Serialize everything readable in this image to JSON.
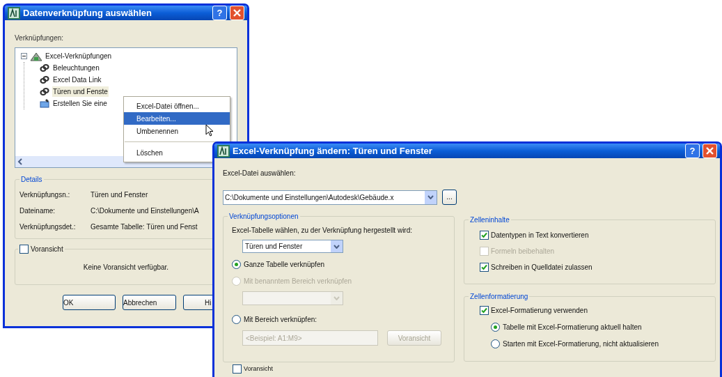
{
  "link_dialog": {
    "title": "Datenverknüpfung auswählen",
    "help_label": "?",
    "tree_label": "Verknüpfungen:",
    "tree": {
      "label": "Excel-Verknüpfungen",
      "expanded": true,
      "children": [
        {
          "label": "Beleuchtungen",
          "kind": "link",
          "selected": false
        },
        {
          "label": "Excel Data Link",
          "kind": "link",
          "selected": false
        },
        {
          "label": "Türen und Fenste",
          "kind": "link",
          "selected": true
        },
        {
          "label": "Erstellen Sie eine",
          "kind": "create",
          "selected": false
        }
      ]
    },
    "details": {
      "title": "Details",
      "rows": [
        {
          "label": "Verknüpfungsn.:",
          "value": "Türen und Fenster"
        },
        {
          "label": "Dateiname:",
          "value": "C:\\Dokumente und Einstellungen\\A"
        },
        {
          "label": "Verknüpfungsdet.:",
          "value": "Gesamte Tabelle: Türen und Fenst"
        }
      ]
    },
    "preview": {
      "label": "Voransicht",
      "checked": false,
      "message": "Keine Voransicht verfügbar."
    },
    "buttons": [
      "OK",
      "Abbrechen",
      "Hi"
    ]
  },
  "context_menu": [
    {
      "kind": "item",
      "label": "Excel-Datei öffnen...",
      "selected": false
    },
    {
      "kind": "item",
      "label": "Bearbeiten...",
      "selected": true
    },
    {
      "kind": "item",
      "label": "Umbenennen",
      "selected": false
    },
    {
      "kind": "separator"
    },
    {
      "kind": "item",
      "label": "Löschen",
      "selected": false
    }
  ],
  "edit_dialog": {
    "title": "Excel-Verknüpfung ändern: Türen und Fenster",
    "help_label": "?",
    "file_label": "Excel-Datei auswählen:",
    "file_value": "C:\\Dokumente und Einstellungen\\Autodesk\\Gebäude.x",
    "browse_label": "...",
    "options": {
      "title": "Verknüpfungsoptionen",
      "sheet_label": "Excel-Tabelle wählen, zu der Verknüpfung hergestellt wird:",
      "sheet_value": "Türen und Fenster",
      "radios": [
        {
          "label": "Ganze Tabelle verknüpfen",
          "selected": true,
          "disabled": false
        },
        {
          "label": "Mit benanntem Bereich verknüpfen",
          "selected": false,
          "disabled": true
        },
        {
          "label": "Mit Bereich verknüpfen:",
          "selected": false,
          "disabled": false
        }
      ],
      "range_placeholder": "<Beispiel: A1:M9>",
      "preview_button": "Voransicht"
    },
    "cell_contents": {
      "title": "Zelleninhalte",
      "checkboxes": [
        {
          "label": "Datentypen in Text konvertieren",
          "checked": true,
          "disabled": false
        },
        {
          "label": "Formeln beibehalten",
          "checked": false,
          "disabled": true
        },
        {
          "label": "Schreiben in Quelldatei zulassen",
          "checked": true,
          "disabled": false
        }
      ]
    },
    "cell_formatting": {
      "title": "Zellenformatierung",
      "checkbox": {
        "label": "Excel-Formatierung verwenden",
        "checked": true
      },
      "radios": [
        {
          "label": "Tabelle mit Excel-Formatierung aktuell halten",
          "selected": true
        },
        {
          "label": "Starten mit Excel-Formatierung, nicht aktualisieren",
          "selected": false
        }
      ]
    },
    "preview_checkbox": {
      "label": "Voransicht",
      "checked": false
    }
  }
}
